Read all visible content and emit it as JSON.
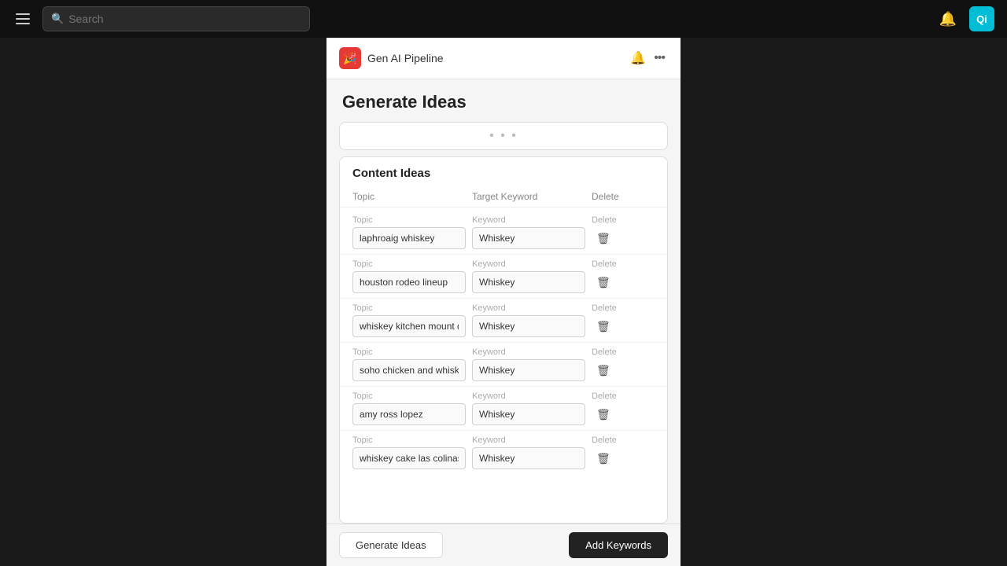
{
  "nav": {
    "search_placeholder": "Search",
    "avatar_initials": "Qi",
    "avatar_color": "#00bcd4"
  },
  "panel": {
    "app_name": "Gen AI Pipeline",
    "logo_icon": "🎉",
    "logo_color": "#e53935"
  },
  "page": {
    "title": "Generate Ideas"
  },
  "content_ideas": {
    "section_title": "Content Ideas",
    "col_topic": "Topic",
    "col_keyword": "Target Keyword",
    "col_delete": "Delete",
    "rows": [
      {
        "topic_label": "Topic",
        "topic_value": "laphroaig whiskey",
        "keyword_label": "Keyword",
        "keyword_value": "Whiskey",
        "delete_label": "Delete"
      },
      {
        "topic_label": "Topic",
        "topic_value": "houston rodeo lineup",
        "keyword_label": "Keyword",
        "keyword_value": "Whiskey",
        "delete_label": "Delete"
      },
      {
        "topic_label": "Topic",
        "topic_value": "whiskey kitchen mount dora",
        "keyword_label": "Keyword",
        "keyword_value": "Whiskey",
        "delete_label": "Delete"
      },
      {
        "topic_label": "Topic",
        "topic_value": "soho chicken and whiskey",
        "keyword_label": "Keyword",
        "keyword_value": "Whiskey",
        "delete_label": "Delete"
      },
      {
        "topic_label": "Topic",
        "topic_value": "amy ross lopez",
        "keyword_label": "Keyword",
        "keyword_value": "Whiskey",
        "delete_label": "Delete"
      },
      {
        "topic_label": "Topic",
        "topic_value": "whiskey cake las colinas",
        "keyword_label": "Keyword",
        "keyword_value": "Whiskey",
        "delete_label": "Delete"
      }
    ]
  },
  "actions": {
    "generate_label": "Generate Ideas",
    "add_keywords_label": "Add Keywords"
  }
}
